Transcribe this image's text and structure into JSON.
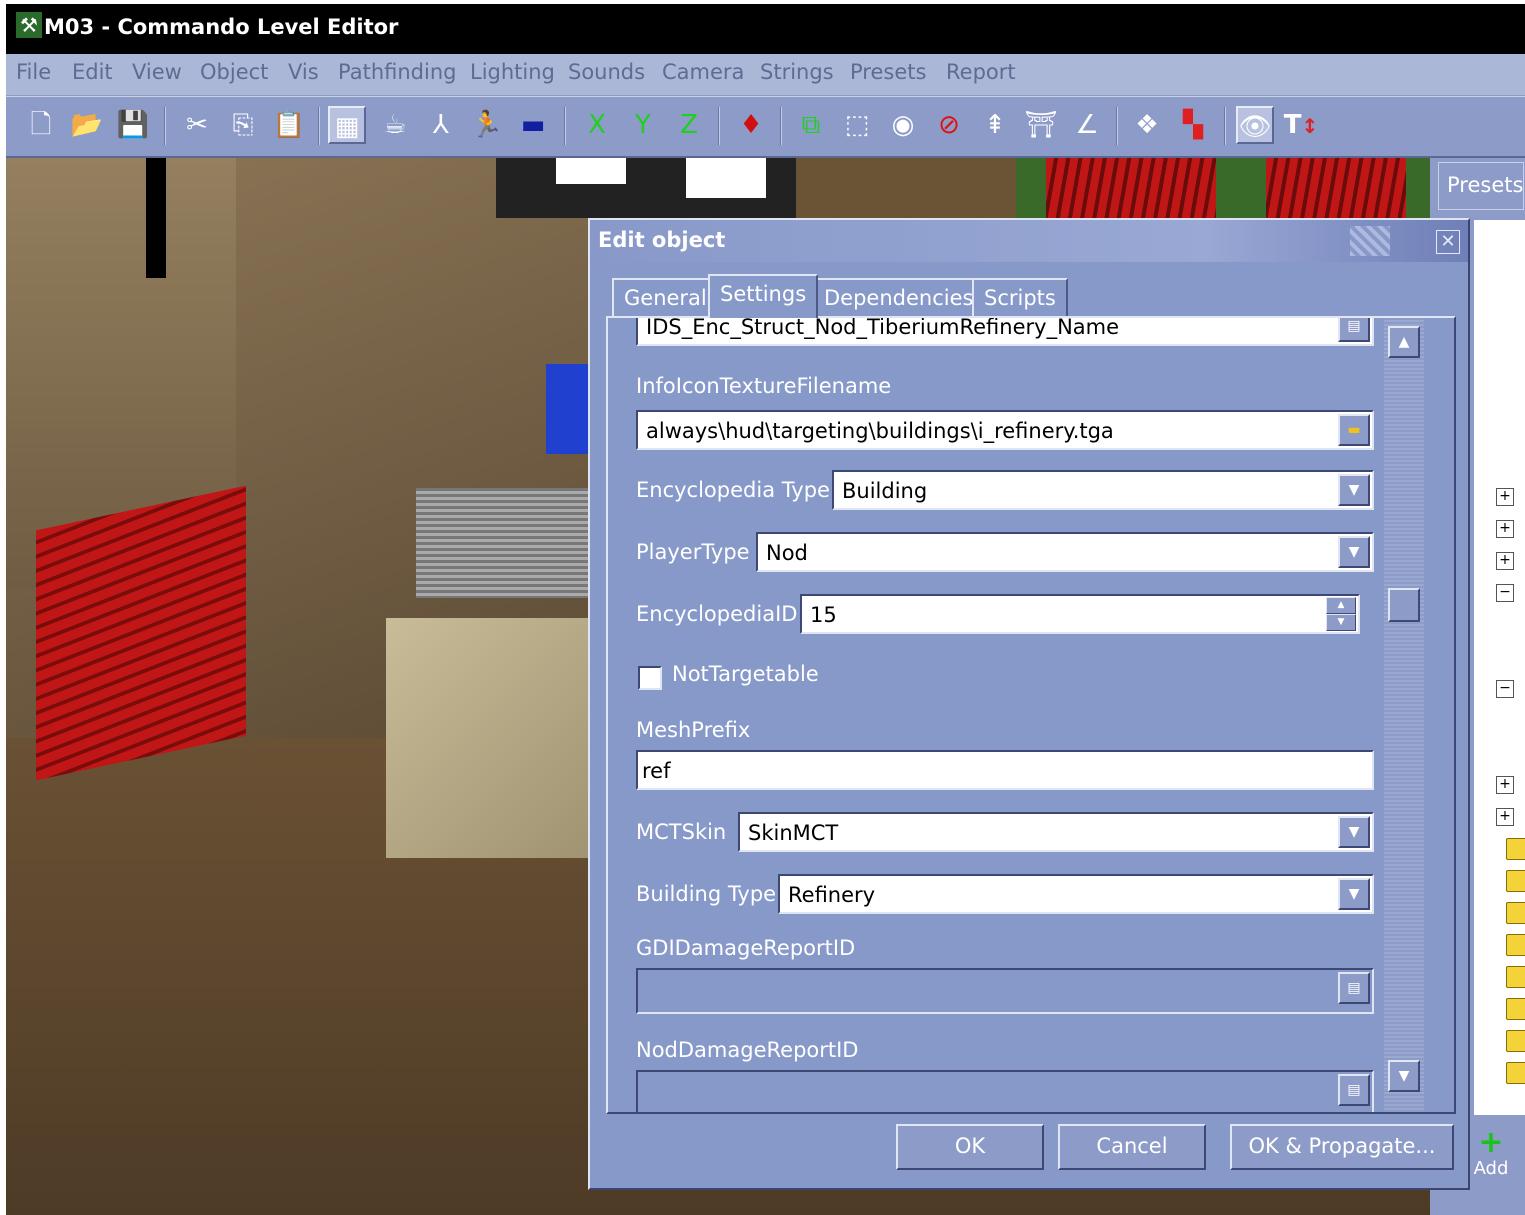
{
  "window": {
    "title": "M03 - Commando Level Editor"
  },
  "menu": [
    "File",
    "Edit",
    "View",
    "Object",
    "Vis",
    "Pathfinding",
    "Lighting",
    "Sounds",
    "Camera",
    "Strings",
    "Presets",
    "Report"
  ],
  "toolbar": {
    "axis_x": "X",
    "axis_y": "Y",
    "axis_z": "Z",
    "text_tool": "T"
  },
  "presets_panel": {
    "tab_label": "Presets",
    "add_label": "Add"
  },
  "dialog": {
    "title": "Edit object",
    "tabs": [
      "General",
      "Settings",
      "Dependencies",
      "Scripts"
    ],
    "active_tab": "Settings",
    "fields": {
      "name_string_value": "IDS_Enc_Struct_Nod_TiberiumRefinery_Name",
      "info_icon_label": "InfoIconTextureFilename",
      "info_icon_value": "always\\hud\\targeting\\buildings\\i_refinery.tga",
      "encyclopedia_type_label": "Encyclopedia Type",
      "encyclopedia_type_value": "Building",
      "player_type_label": "PlayerType",
      "player_type_value": "Nod",
      "encyclopedia_id_label": "EncyclopediaID",
      "encyclopedia_id_value": "15",
      "not_targetable_label": "NotTargetable",
      "not_targetable_checked": false,
      "mesh_prefix_label": "MeshPrefix",
      "mesh_prefix_value": "ref",
      "mct_skin_label": "MCTSkin",
      "mct_skin_value": "SkinMCT",
      "building_type_label": "Building Type",
      "building_type_value": "Refinery",
      "gdi_damage_label": "GDIDamageReportID",
      "gdi_damage_value": "",
      "nod_damage_label": "NodDamageReportID",
      "nod_damage_value": ""
    },
    "buttons": {
      "ok": "OK",
      "cancel": "Cancel",
      "ok_propagate": "OK & Propagate..."
    }
  },
  "colors": {
    "dialog_bg": "#8799c8",
    "menu_bg": "#aab7d6",
    "toolbar_bg": "#8d9bc8",
    "title_bar": "#000000"
  }
}
